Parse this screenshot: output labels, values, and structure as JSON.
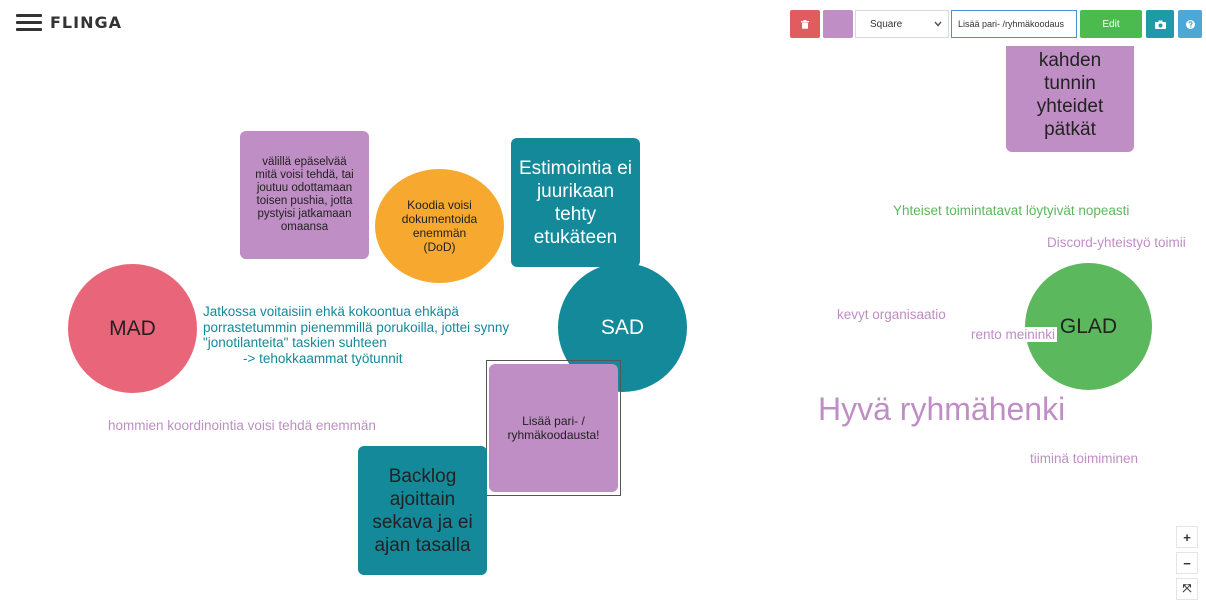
{
  "header": {
    "logo": "FLINGA",
    "shape_select": {
      "value": "Square"
    },
    "note_text_input": {
      "value": "Lisää pari- /ryhmäkoodaus"
    },
    "edit_label": "Edit",
    "colors": {
      "delete": "#e05c5f",
      "note_color": "#bf8ec4",
      "edit": "#4cbb4f",
      "camera": "#1f9aa8",
      "help": "#4fa7d6"
    },
    "icons": [
      "menu-icon",
      "trash-icon",
      "camera-icon",
      "question-icon"
    ]
  },
  "board": {
    "circles": {
      "mad": "MAD",
      "sad": "SAD",
      "glad": "GLAD",
      "dod": "Koodia voisi dokumentoida enemmän (DoD)"
    },
    "notes": {
      "unclear_tasks": "välillä epäselvää mitä voisi tehdä, tai joutuu odottamaan toisen pushia, jotta pystyisi jatkamaan omaansa",
      "estimation": "Estimointia ei juurikaan tehty etukäteen",
      "pair_coding": "Lisää pari- / ryhmäkoodausta!",
      "backlog": "Backlog ajoittain sekava ja ei ajan tasalla",
      "two_hours": "kahden tunnin yhteidet pätkät"
    },
    "free_texts": {
      "future_line1": "Jatkossa voitaisiin ehkä kokoontua ehkäpä",
      "future_line2": "porrastetummin pienemmillä porukoilla, jottei synny",
      "future_line3": "\"jonotilanteita\" taskien suhteen",
      "future_line4": "-> tehokkaammat työtunnit",
      "coordination": "hommien koordinointia voisi tehdä enemmän",
      "common_practices": "Yhteiset toimintatavat löytyivät nopeasti",
      "discord": "Discord-yhteistyö toimii",
      "light_org": "kevyt organisaatio",
      "relaxed": "rento meininki",
      "team_spirit": "Hyvä ryhmähenki",
      "teamwork": "tiiminä toimiminen"
    },
    "colors": {
      "mad": "#e9667a",
      "sad": "#14899a",
      "glad": "#5cb85c",
      "dod": "#f6a92e",
      "purple": "#bf8ec4",
      "teal": "#14899a",
      "green_text": "#5cb85c",
      "purple_text": "#bf8ec4",
      "teal_text": "#14899a"
    }
  },
  "zoom_controls": {
    "zoom_in": "+",
    "zoom_out": "−",
    "fit": "⤧"
  }
}
